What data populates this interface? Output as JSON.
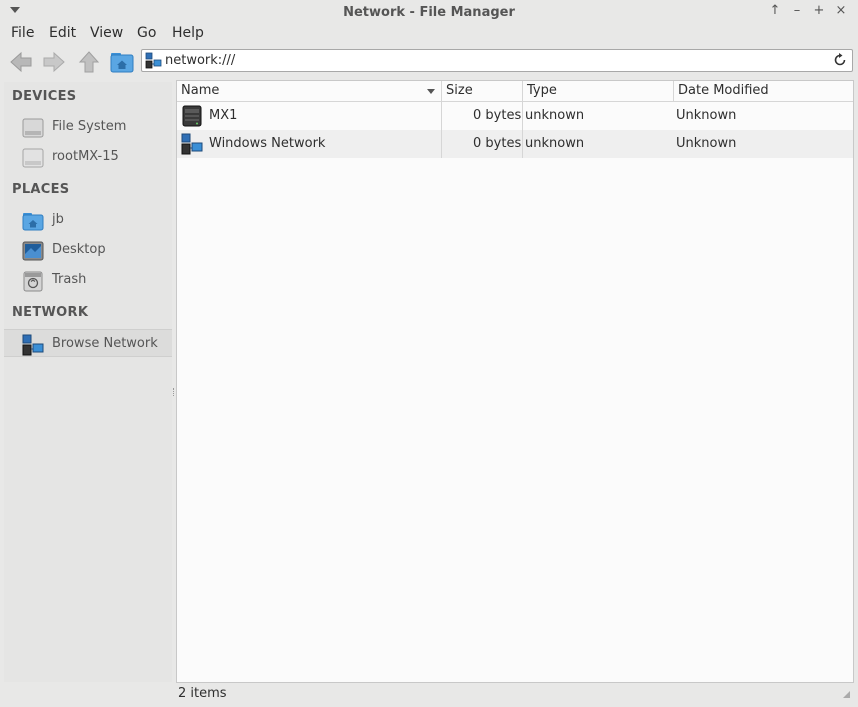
{
  "window": {
    "title": "Network - File Manager"
  },
  "menubar": {
    "items": [
      "File",
      "Edit",
      "View",
      "Go",
      "Help"
    ]
  },
  "location": {
    "path": "network:///"
  },
  "sidebar": {
    "devices_heading": "DEVICES",
    "places_heading": "PLACES",
    "network_heading": "NETWORK",
    "devices": [
      {
        "label": "File System",
        "icon": "drive-icon"
      },
      {
        "label": "rootMX-15",
        "icon": "drive-icon"
      }
    ],
    "places": [
      {
        "label": "jb",
        "icon": "home-folder-icon"
      },
      {
        "label": "Desktop",
        "icon": "desktop-icon"
      },
      {
        "label": "Trash",
        "icon": "trash-icon"
      }
    ],
    "network": [
      {
        "label": "Browse Network",
        "icon": "network-icon",
        "selected": true
      }
    ]
  },
  "columns": [
    "Name",
    "Size",
    "Type",
    "Date Modified"
  ],
  "rows": [
    {
      "name": "MX1",
      "size": "0 bytes",
      "type": "unknown",
      "modified": "Unknown",
      "icon": "server-icon"
    },
    {
      "name": "Windows Network",
      "size": "0 bytes",
      "type": "unknown",
      "modified": "Unknown",
      "icon": "network-icon"
    }
  ],
  "status": {
    "text": "2 items"
  },
  "colors": {
    "accent_blue": "#3a8fd6",
    "window_bg": "#e8e8e7",
    "list_bg": "#fbfbfb"
  }
}
